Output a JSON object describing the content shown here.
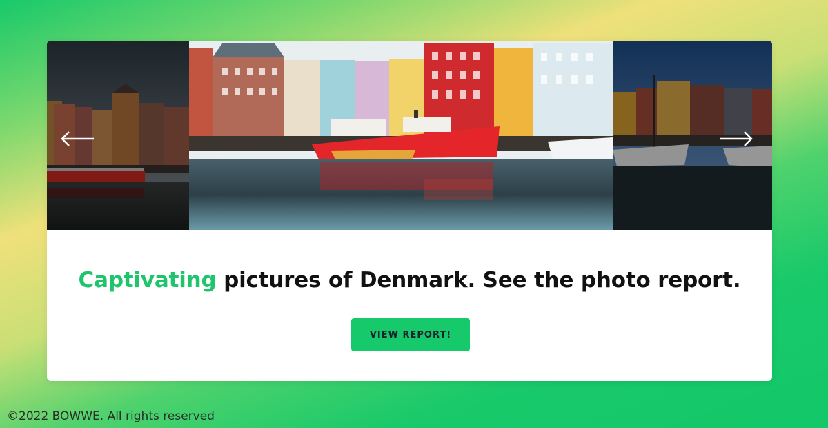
{
  "slider": {
    "slides": [
      {
        "name": "slide-previous",
        "icon": "harbor-photo"
      },
      {
        "name": "slide-current",
        "icon": "harbor-photo"
      },
      {
        "name": "slide-next",
        "icon": "harbor-photo"
      }
    ],
    "prev_icon": "arrow-left-icon",
    "next_icon": "arrow-right-icon"
  },
  "headline": {
    "accent": "Captivating",
    "rest": " pictures of Denmark. See the photo report."
  },
  "cta": {
    "label": "VIEW REPORT!"
  },
  "footer": {
    "copyright": "©2022 BOWWE. All rights reserved"
  },
  "colors": {
    "accent": "#1ec56b",
    "button": "#16c96a",
    "card": "#ffffff"
  }
}
